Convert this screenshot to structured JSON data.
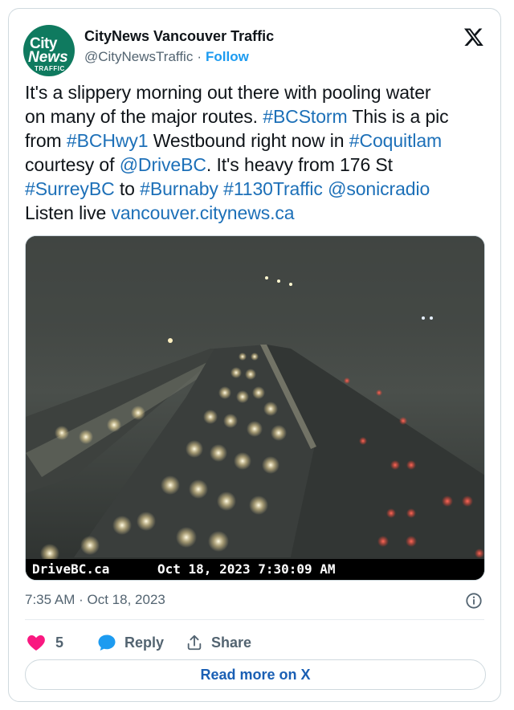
{
  "account": {
    "name": "CityNews Vancouver Traffic",
    "handle": "@CityNewsTraffic",
    "separator": "·",
    "follow_label": "Follow",
    "avatar": {
      "logo_city": "City",
      "logo_news": "News",
      "logo_traffic": "TRAFFIC"
    }
  },
  "tweet": {
    "line1": "It's a slippery morning out there with pooling water",
    "line2_a": "on many of the major routes. ",
    "line2_tag": "#BCStorm",
    "line2_b": " This is a pic",
    "line3_a": "from ",
    "line3_tag1": "#BCHwy1",
    "line3_b": " Westbound right now in ",
    "line3_tag2": "#Coquitlam",
    "line4_a": "courtesy of ",
    "line4_mention": "@DriveBC",
    "line4_b": ". It's heavy from 176 St",
    "line5_tag1": "#SurreyBC",
    "line5_b": " to ",
    "line5_tag2": "#Burnaby",
    "line5_tag3": "#1130Traffic",
    "line5_mention": "@sonicradio",
    "line6_a": "Listen live ",
    "line6_link": "vancouver.citynews.ca"
  },
  "media": {
    "caption_left": "DriveBC.ca",
    "caption_right": "Oct 18, 2023 7:30:09 AM"
  },
  "meta": {
    "time": "7:35 AM",
    "separator": "·",
    "date": "Oct 18, 2023"
  },
  "actions": {
    "like_count": "5",
    "reply_label": "Reply",
    "share_label": "Share"
  },
  "read_more_label": "Read more on X",
  "colors": {
    "link": "#1d70b8",
    "follow": "#1d9bf0",
    "heart": "#f91880",
    "reply_bubble": "#1d9bf0",
    "avatar_bg": "#0f7a5f"
  },
  "icons": [
    "x-logo-icon",
    "info-icon",
    "heart-icon",
    "reply-bubble-icon",
    "share-icon"
  ]
}
